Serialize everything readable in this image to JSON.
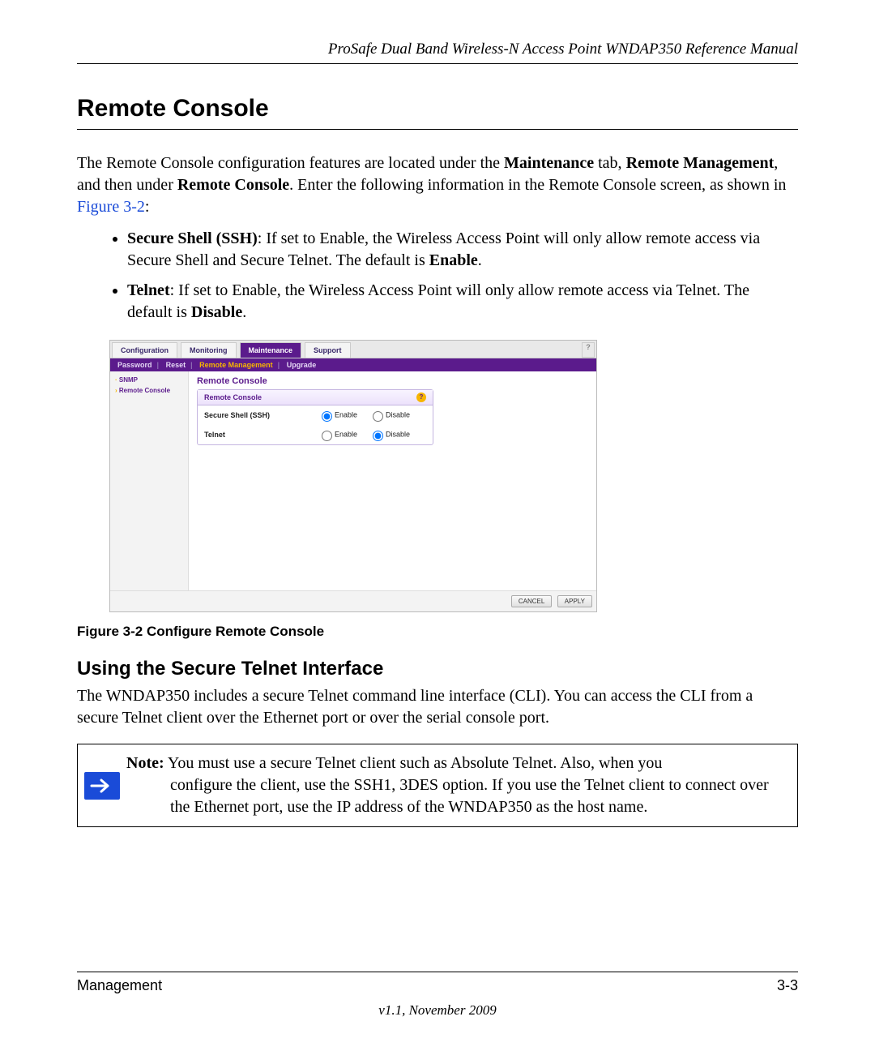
{
  "header": {
    "manual_title": "ProSafe Dual Band Wireless-N Access Point WNDAP350 Reference Manual"
  },
  "section": {
    "title": "Remote Console",
    "intro_pre": "The Remote Console configuration features are located under the ",
    "intro_bold1": "Maintenance",
    "intro_mid1": " tab, ",
    "intro_bold2": "Remote Management",
    "intro_mid2": ", and then under ",
    "intro_bold3": "Remote Console",
    "intro_mid3": ". Enter the following information in the Remote Console screen, as shown in ",
    "intro_link": "Figure 3-2",
    "intro_end": ":"
  },
  "bullets": {
    "b1_label": "Secure Shell (SSH)",
    "b1_text": ": If set to Enable, the Wireless Access Point will only allow remote access via Secure Shell and Secure Telnet. The default is ",
    "b1_bold_end": "Enable",
    "b1_period": ".",
    "b2_label": "Telnet",
    "b2_text": ": If set to Enable, the Wireless Access Point will only allow remote access via Telnet. The default is ",
    "b2_bold_end": "Disable",
    "b2_period": "."
  },
  "screenshot": {
    "tabs": [
      "Configuration",
      "Monitoring",
      "Maintenance",
      "Support"
    ],
    "active_tab_index": 2,
    "subtabs": {
      "items": [
        "Password",
        "Reset",
        "Remote Management",
        "Upgrade"
      ],
      "active_index": 2
    },
    "sidebar": {
      "items": [
        "SNMP",
        "Remote Console"
      ]
    },
    "panel": {
      "title": "Remote Console",
      "box_title": "Remote Console",
      "rows": [
        {
          "label": "Secure Shell (SSH)",
          "enable": "Enable",
          "disable": "Disable",
          "selected": "enable"
        },
        {
          "label": "Telnet",
          "enable": "Enable",
          "disable": "Disable",
          "selected": "disable"
        }
      ]
    },
    "buttons": {
      "cancel": "CANCEL",
      "apply": "APPLY"
    }
  },
  "figure_caption": "Figure 3-2  Configure Remote Console",
  "subsection": {
    "title": "Using the Secure Telnet Interface",
    "text": "The WNDAP350 includes a secure Telnet command line interface (CLI). You can access the CLI from a secure Telnet client over the Ethernet port or over the serial console port."
  },
  "note": {
    "label": "Note:",
    "line1": " You must use a secure Telnet client such as Absolute Telnet. Also, when you",
    "rest": "configure the client, use the SSH1, 3DES option. If you use the Telnet client to connect over the Ethernet port, use the IP address of the WNDAP350 as the host name."
  },
  "footer": {
    "left": "Management",
    "right": "3-3",
    "version": "v1.1, November 2009"
  }
}
